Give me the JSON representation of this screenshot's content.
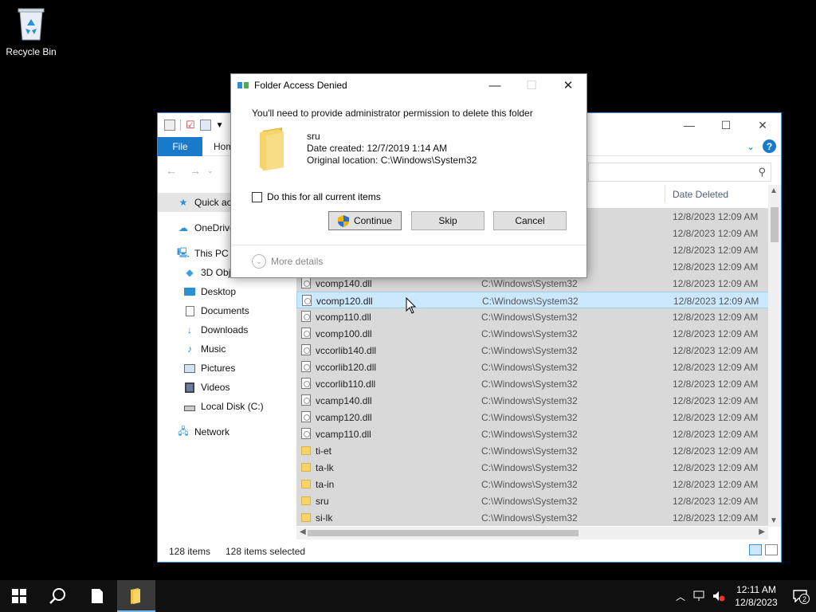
{
  "desktop": {
    "recycle_bin_label": "Recycle Bin"
  },
  "explorer": {
    "tab_file": "File",
    "tab_home": "Hom",
    "nav": {
      "quick_access": "Quick ac",
      "onedrive": "OneDrive",
      "this_pc": "This PC",
      "objects_3d": "3D Objects",
      "desktop": "Desktop",
      "documents": "Documents",
      "downloads": "Downloads",
      "music": "Music",
      "pictures": "Pictures",
      "videos": "Videos",
      "local_disk": "Local Disk (C:)",
      "network": "Network"
    },
    "column_date_deleted": "Date Deleted",
    "rows": [
      {
        "name": "",
        "location": "",
        "date": "12/8/2023 12:09 AM",
        "type": "dll"
      },
      {
        "name": "",
        "location": "",
        "date": "12/8/2023 12:09 AM",
        "type": "dll"
      },
      {
        "name": "",
        "location": "",
        "date": "12/8/2023 12:09 AM",
        "type": "dll"
      },
      {
        "name": "",
        "location": "",
        "date": "12/8/2023 12:09 AM",
        "type": "dll"
      },
      {
        "name": "vcomp140.dll",
        "location": "C:\\Windows\\System32",
        "date": "12/8/2023 12:09 AM",
        "type": "dll"
      },
      {
        "name": "vcomp120.dll",
        "location": "C:\\Windows\\System32",
        "date": "12/8/2023 12:09 AM",
        "type": "dll",
        "focused": true
      },
      {
        "name": "vcomp110.dll",
        "location": "C:\\Windows\\System32",
        "date": "12/8/2023 12:09 AM",
        "type": "dll"
      },
      {
        "name": "vcomp100.dll",
        "location": "C:\\Windows\\System32",
        "date": "12/8/2023 12:09 AM",
        "type": "dll"
      },
      {
        "name": "vccorlib140.dll",
        "location": "C:\\Windows\\System32",
        "date": "12/8/2023 12:09 AM",
        "type": "dll"
      },
      {
        "name": "vccorlib120.dll",
        "location": "C:\\Windows\\System32",
        "date": "12/8/2023 12:09 AM",
        "type": "dll"
      },
      {
        "name": "vccorlib110.dll",
        "location": "C:\\Windows\\System32",
        "date": "12/8/2023 12:09 AM",
        "type": "dll"
      },
      {
        "name": "vcamp140.dll",
        "location": "C:\\Windows\\System32",
        "date": "12/8/2023 12:09 AM",
        "type": "dll"
      },
      {
        "name": "vcamp120.dll",
        "location": "C:\\Windows\\System32",
        "date": "12/8/2023 12:09 AM",
        "type": "dll"
      },
      {
        "name": "vcamp110.dll",
        "location": "C:\\Windows\\System32",
        "date": "12/8/2023 12:09 AM",
        "type": "dll"
      },
      {
        "name": "ti-et",
        "location": "C:\\Windows\\System32",
        "date": "12/8/2023 12:09 AM",
        "type": "folder"
      },
      {
        "name": "ta-lk",
        "location": "C:\\Windows\\System32",
        "date": "12/8/2023 12:09 AM",
        "type": "folder"
      },
      {
        "name": "ta-in",
        "location": "C:\\Windows\\System32",
        "date": "12/8/2023 12:09 AM",
        "type": "folder"
      },
      {
        "name": "sru",
        "location": "C:\\Windows\\System32",
        "date": "12/8/2023 12:09 AM",
        "type": "folder"
      },
      {
        "name": "si-lk",
        "location": "C:\\Windows\\System32",
        "date": "12/8/2023 12:09 AM",
        "type": "folder"
      }
    ],
    "status_count": "128 items",
    "status_selected": "128 items selected"
  },
  "dialog": {
    "title": "Folder Access Denied",
    "message": "You'll need to provide administrator permission to delete this folder",
    "folder_name": "sru",
    "date_created": "Date created: 12/7/2019 1:14 AM",
    "original_location": "Original location: C:\\Windows\\System32",
    "checkbox_label": "Do this for all current items",
    "continue_label": "Continue",
    "skip_label": "Skip",
    "cancel_label": "Cancel",
    "more_details_label": "More details"
  },
  "taskbar": {
    "clock_time": "12:11 AM",
    "clock_date": "12/8/2023",
    "notification_count": "2"
  },
  "colors": {
    "accent": "#1979ca",
    "selection": "#cce8ff",
    "selected_row_bg": "#d9d9d9"
  }
}
